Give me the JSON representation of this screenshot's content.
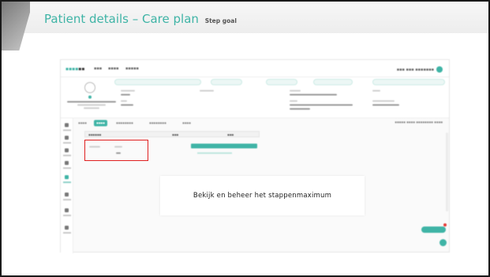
{
  "slide": {
    "title": "Patient details – Care plan",
    "subtitle": "Step goal",
    "caption": "Bekijk en beheer het stappenmaximum"
  },
  "colors": {
    "accent": "#3fb4a6",
    "highlight": "#e02020",
    "frame": "#1a1a1a"
  },
  "icons": [
    "avatar-icon",
    "user-icon",
    "notification-dot"
  ]
}
